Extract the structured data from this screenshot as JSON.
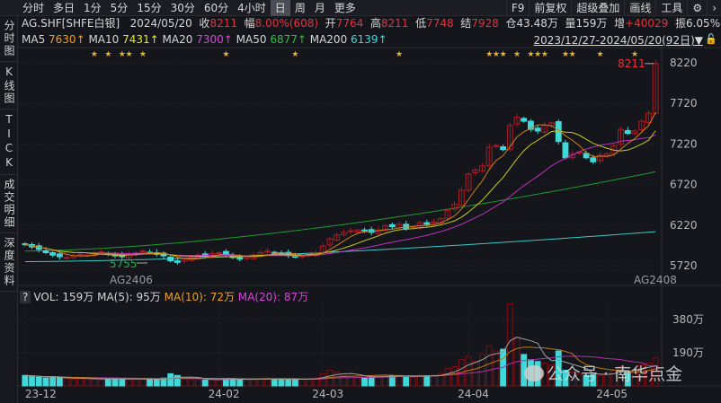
{
  "topbar": {
    "periods": [
      "分时",
      "多日",
      "1分",
      "5分",
      "15分",
      "30分",
      "60分",
      "4小时",
      "日",
      "周",
      "月",
      "更多"
    ],
    "active_period": "日",
    "tools": [
      "F9",
      "前复权",
      "超级叠加",
      "画线",
      "工具"
    ],
    "settings_icon": "gear-icon",
    "more_icon": "chevron-right-icon"
  },
  "sidebar": [
    "分时图",
    "K线图",
    "TICK",
    "成交明细",
    "深度资料"
  ],
  "quote": {
    "symbol": "AG.SHF[SHFE白银]",
    "date": "2024/05/20",
    "close_label": "收",
    "close": "8211",
    "change_label": "幅",
    "change": "8.00%(608)",
    "open_label": "开",
    "open": "7764",
    "high_label": "高",
    "high": "8211",
    "low_label": "低",
    "low": "7748",
    "settle_label": "结",
    "settle": "7928",
    "oi_label": "仓",
    "oi": "43.48万",
    "vol_label": "量",
    "vol": "159万",
    "oi_chg_label": "增",
    "oi_chg": "+40029",
    "amp_label": "振",
    "amp": "6.05%"
  },
  "ma": [
    {
      "label": "MA5",
      "value": "7630↑",
      "color": "#f0a020"
    },
    {
      "label": "MA10",
      "value": "7431↑",
      "color": "#e6e62e"
    },
    {
      "label": "MA20",
      "value": "7300↑",
      "color": "#e040e0"
    },
    {
      "label": "MA50",
      "value": "6877↑",
      "color": "#2cc040"
    },
    {
      "label": "MA200",
      "value": "6139↑",
      "color": "#40d8d8"
    }
  ],
  "date_range": "2023/12/27-2024/05/20(92日)▼",
  "price_axis": [
    "8220",
    "7720",
    "7220",
    "6720",
    "6220",
    "5720"
  ],
  "contracts": {
    "left": "AG2406",
    "right": "AG2408"
  },
  "markers": {
    "high": "8211",
    "low": "5755"
  },
  "vol_legend": {
    "help": "?",
    "vol": "VOL: 159万",
    "ma5": "MA(5): 95万",
    "ma10": "MA(10): 72万",
    "ma20": "MA(20): 87万"
  },
  "vol_axis": [
    "380万",
    "190万"
  ],
  "date_axis": [
    "23-12",
    "24-02",
    "24-03",
    "24-04",
    "24-05"
  ],
  "watermark": "公众号 · 南华点金",
  "chart_data": {
    "type": "candlestick",
    "ylim": [
      5600,
      8300
    ],
    "closes": [
      5980,
      5950,
      5920,
      5880,
      5850,
      5830,
      5820,
      5840,
      5860,
      5850,
      5870,
      5890,
      5860,
      5840,
      5830,
      5860,
      5880,
      5900,
      5880,
      5860,
      5840,
      5780,
      5760,
      5800,
      5830,
      5850,
      5840,
      5870,
      5880,
      5860,
      5820,
      5800,
      5820,
      5850,
      5880,
      5900,
      5880,
      5870,
      5850,
      5830,
      5840,
      5860,
      5880,
      5960,
      6050,
      6100,
      6130,
      6150,
      6160,
      6150,
      6130,
      6160,
      6210,
      6200,
      6230,
      6180,
      6200,
      6250,
      6230,
      6260,
      6300,
      6400,
      6480,
      6650,
      6850,
      6900,
      6950,
      7180,
      7200,
      7150,
      7450,
      7550,
      7500,
      7400,
      7380,
      7450,
      7480,
      7250,
      7050,
      7100,
      7120,
      7050,
      7000,
      7080,
      7100,
      7200,
      7400,
      7350,
      7380,
      7500,
      7600,
      8211
    ],
    "volumes_wan": [
      60,
      55,
      50,
      45,
      52,
      48,
      40,
      38,
      42,
      45,
      40,
      36,
      38,
      44,
      40,
      42,
      38,
      36,
      40,
      35,
      45,
      70,
      60,
      40,
      38,
      36,
      34,
      38,
      36,
      40,
      42,
      38,
      36,
      40,
      42,
      44,
      40,
      38,
      36,
      40,
      38,
      42,
      46,
      70,
      90,
      80,
      60,
      55,
      50,
      48,
      52,
      55,
      60,
      58,
      62,
      55,
      50,
      60,
      58,
      62,
      70,
      100,
      110,
      150,
      170,
      140,
      180,
      230,
      200,
      210,
      470,
      280,
      180,
      150,
      140,
      130,
      120,
      200,
      90,
      80,
      70,
      60,
      65,
      60,
      75,
      90,
      110,
      80,
      90,
      120,
      130,
      159
    ],
    "ma50_range": [
      5900,
      6877
    ],
    "ma200_range": [
      5770,
      6139
    ],
    "star_days": [
      10,
      12,
      14,
      15,
      17,
      29,
      39,
      54,
      67,
      68,
      69,
      71,
      73,
      74,
      75,
      78,
      79,
      83,
      88
    ]
  }
}
